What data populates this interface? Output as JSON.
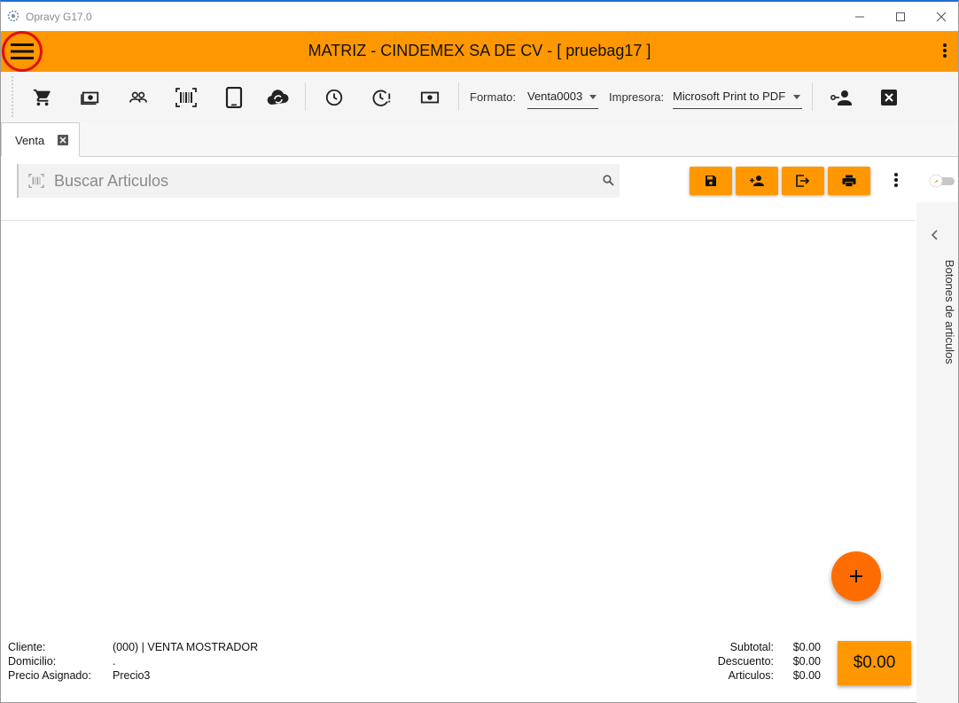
{
  "window": {
    "title": "Opravy G17.0",
    "controls": [
      "minimize",
      "maximize",
      "close"
    ]
  },
  "header": {
    "title": "MATRIZ - CINDEMEX SA DE CV - [ pruebag17 ]",
    "accent": "#ff9800"
  },
  "toolbar": {
    "icons": [
      "cart-icon",
      "cash-icon",
      "customers-icon",
      "barcode-icon",
      "tablet-icon",
      "cloud-sync-icon",
      "clock-icon",
      "clock-alert-icon",
      "money-icon"
    ],
    "formato_label": "Formato:",
    "formato_value": "Venta0003",
    "impresora_label": "Impresora:",
    "impresora_value": "Microsoft Print to PDF"
  },
  "tabs": [
    {
      "label": "Venta",
      "active": true
    }
  ],
  "search": {
    "placeholder": "Buscar Articulos",
    "value": ""
  },
  "side_panel": {
    "label": "Botones de articulos"
  },
  "footer": {
    "cliente_label": "Cliente:",
    "cliente_value": "(000) | VENTA MOSTRADOR",
    "domicilio_label": "Domicilio:",
    "domicilio_value": ".",
    "precio_label": "Precio Asignado:",
    "precio_value": "Precio3",
    "subtotal_label": "Subtotal:",
    "subtotal_value": "$0.00",
    "descuento_label": "Descuento:",
    "descuento_value": "$0.00",
    "articulos_label": "Articulos:",
    "articulos_value": "$0.00",
    "total": "$0.00"
  }
}
